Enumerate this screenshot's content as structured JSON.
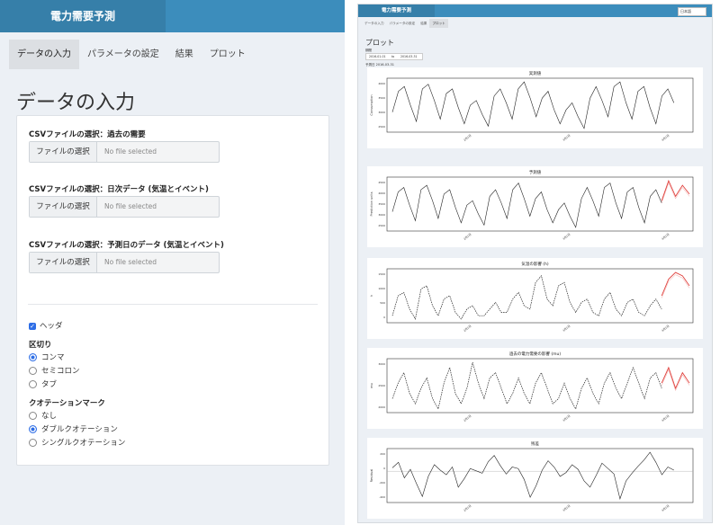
{
  "left": {
    "app_title": "電力需要予測",
    "tabs": [
      "データの入力",
      "パラメータの設定",
      "結果",
      "プロット"
    ],
    "page_title": "データの入力",
    "file_inputs": [
      {
        "label": "CSVファイルの選択：過去の需要",
        "button": "ファイルの選択",
        "value": "No file selected"
      },
      {
        "label": "CSVファイルの選択：日次データ (気温とイベント)",
        "button": "ファイルの選択",
        "value": "No file selected"
      },
      {
        "label": "CSVファイルの選択：予測日のデータ (気温とイベント)",
        "button": "ファイルの選択",
        "value": "No file selected"
      }
    ],
    "header_checkbox": "ヘッダ",
    "separator": {
      "label": "区切り",
      "options": [
        "コンマ",
        "セミコロン",
        "タブ"
      ],
      "selected": "コンマ"
    },
    "quote": {
      "label": "クオテーションマーク",
      "options": [
        "なし",
        "ダブルクオテーション",
        "シングルクオテーション"
      ],
      "selected": "ダブルクオテーション"
    }
  },
  "right": {
    "app_title": "電力需要予測",
    "language": "日本語",
    "tabs": [
      "データの入力",
      "パラメータの設定",
      "結果",
      "プロット"
    ],
    "page_title": "プロット",
    "period_label": "期間",
    "date_from": "2016-01-01",
    "date_sep": "to",
    "date_to": "2016-03-31",
    "sub_label": "予測日 2016-03-31",
    "accent": "#3c8dbc",
    "forecast_color": "#e0403c"
  },
  "chart_data": [
    {
      "type": "line",
      "title": "実測値",
      "ylabel": "Consumption",
      "yticks": [
        "4000",
        "3500",
        "3000",
        "2500"
      ],
      "xticks": [
        "2月1日",
        "3月1日",
        "4月1日"
      ],
      "series": [
        {
          "values": [
            2.9,
            3.8,
            4.0,
            3.2,
            2.5,
            3.9,
            4.1,
            3.4,
            2.6,
            3.7,
            3.9,
            3.1,
            2.4,
            3.2,
            3.4,
            2.8,
            2.3,
            3.6,
            3.9,
            3.3,
            2.6,
            3.9,
            4.2,
            3.5,
            2.7,
            3.5,
            3.8,
            3.0,
            2.4,
            3.0,
            3.3,
            2.7,
            2.2,
            3.5,
            4.0,
            3.4,
            2.7,
            4.0,
            4.2,
            3.3,
            2.6,
            3.8,
            4.0,
            3.1,
            2.4,
            3.6,
            3.9,
            3.3
          ]
        }
      ]
    },
    {
      "type": "line",
      "title": "予測値",
      "ylabel": "Prediction units",
      "yticks": [
        "4500",
        "4000",
        "3500",
        "3000",
        "2500"
      ],
      "xticks": [
        "2月1日",
        "3月1日",
        "4月1日"
      ],
      "series": [
        {
          "values": [
            2.9,
            3.8,
            4.0,
            3.2,
            2.5,
            3.9,
            4.1,
            3.4,
            2.6,
            3.7,
            3.9,
            3.1,
            2.4,
            3.2,
            3.4,
            2.8,
            2.3,
            3.6,
            3.9,
            3.3,
            2.6,
            3.9,
            4.2,
            3.5,
            2.7,
            3.5,
            3.8,
            3.0,
            2.4,
            3.0,
            3.3,
            2.7,
            2.2,
            3.5,
            4.0,
            3.4,
            2.7,
            4.0,
            4.2,
            3.3,
            2.6,
            3.8,
            4.0,
            3.1,
            2.4,
            3.6,
            3.9,
            3.3
          ]
        },
        {
          "values": [
            3.4,
            4.3,
            3.6,
            4.1,
            3.7
          ]
        }
      ]
    },
    {
      "type": "line",
      "title": "気温の影響 (h)",
      "ylabel": "h",
      "yticks": [
        "1500",
        "1000",
        "500",
        "0"
      ],
      "xticks": [
        "2月1日",
        "3月1日",
        "4月1日"
      ],
      "series": [
        {
          "values": [
            0.1,
            0.7,
            0.8,
            0.3,
            0.0,
            0.9,
            1.0,
            0.4,
            0.1,
            0.6,
            0.7,
            0.2,
            0.0,
            0.3,
            0.4,
            0.1,
            0.1,
            0.3,
            0.5,
            0.2,
            0.2,
            0.6,
            0.8,
            0.4,
            0.3,
            1.1,
            1.3,
            0.6,
            0.4,
            1.0,
            1.1,
            0.5,
            0.2,
            0.5,
            0.6,
            0.2,
            0.1,
            0.6,
            0.8,
            0.3,
            0.1,
            0.5,
            0.6,
            0.2,
            0.1,
            0.4,
            0.6,
            0.3
          ]
        },
        {
          "values": [
            0.7,
            1.2,
            1.4,
            1.3,
            1.0
          ]
        }
      ]
    },
    {
      "type": "line",
      "title": "過去の電力需要の影響 (mu)",
      "ylabel": "mu",
      "yticks": [
        "3000",
        "2500",
        "2000"
      ],
      "xticks": [
        "2月1日",
        "3月1日",
        "4月1日"
      ],
      "series": [
        {
          "values": [
            2.6,
            2.9,
            3.1,
            2.7,
            2.5,
            2.8,
            3.0,
            2.6,
            2.4,
            2.9,
            3.2,
            2.7,
            2.5,
            2.8,
            3.3,
            2.9,
            2.6,
            3.0,
            3.1,
            2.8,
            2.5,
            2.7,
            3.0,
            2.7,
            2.5,
            2.9,
            3.1,
            2.8,
            2.5,
            2.6,
            2.9,
            2.6,
            2.4,
            2.8,
            3.0,
            2.7,
            2.5,
            2.9,
            3.1,
            2.8,
            2.6,
            2.9,
            3.2,
            2.9,
            2.6,
            3.0,
            3.1,
            2.8
          ]
        },
        {
          "values": [
            2.9,
            3.2,
            2.8,
            3.1,
            2.9
          ]
        }
      ]
    },
    {
      "type": "line",
      "title": "残差",
      "ylabel": "Residual",
      "yticks": [
        "200",
        "0",
        "-200",
        "-400"
      ],
      "xticks": [
        "2月1日",
        "3月1日",
        "4月1日"
      ],
      "series": [
        {
          "values": [
            50,
            120,
            -80,
            30,
            -150,
            -320,
            -60,
            90,
            20,
            -40,
            60,
            -200,
            -90,
            40,
            10,
            -20,
            130,
            210,
            80,
            -30,
            60,
            40,
            -100,
            -330,
            -180,
            20,
            140,
            60,
            -60,
            -10,
            90,
            30,
            -120,
            -200,
            -50,
            110,
            40,
            -30,
            -350,
            -120,
            -20,
            70,
            150,
            250,
            120,
            -40,
            60,
            20
          ]
        }
      ]
    }
  ]
}
